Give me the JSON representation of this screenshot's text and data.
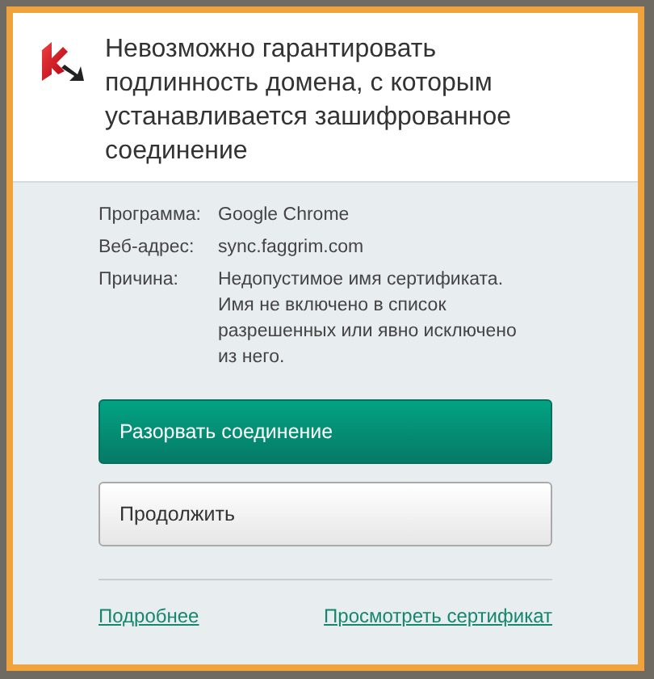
{
  "dialog": {
    "title": "Невозможно гарантировать подлинность домена, с которым устанавливается зашифрованное соединение"
  },
  "details": [
    {
      "label": "Программа:",
      "value": "Google Chrome"
    },
    {
      "label": "Веб-адрес:",
      "value": "sync.faggrim.com"
    },
    {
      "label": "Причина:",
      "value": "Недопустимое имя сертификата. Имя не включено в список разрешенных или явно исключено из него."
    }
  ],
  "buttons": [
    {
      "label": "Разорвать соединение",
      "kind": "primary"
    },
    {
      "label": "Продолжить",
      "kind": "secondary"
    }
  ],
  "links": [
    "Подробнее",
    "Просмотреть сертификат"
  ]
}
